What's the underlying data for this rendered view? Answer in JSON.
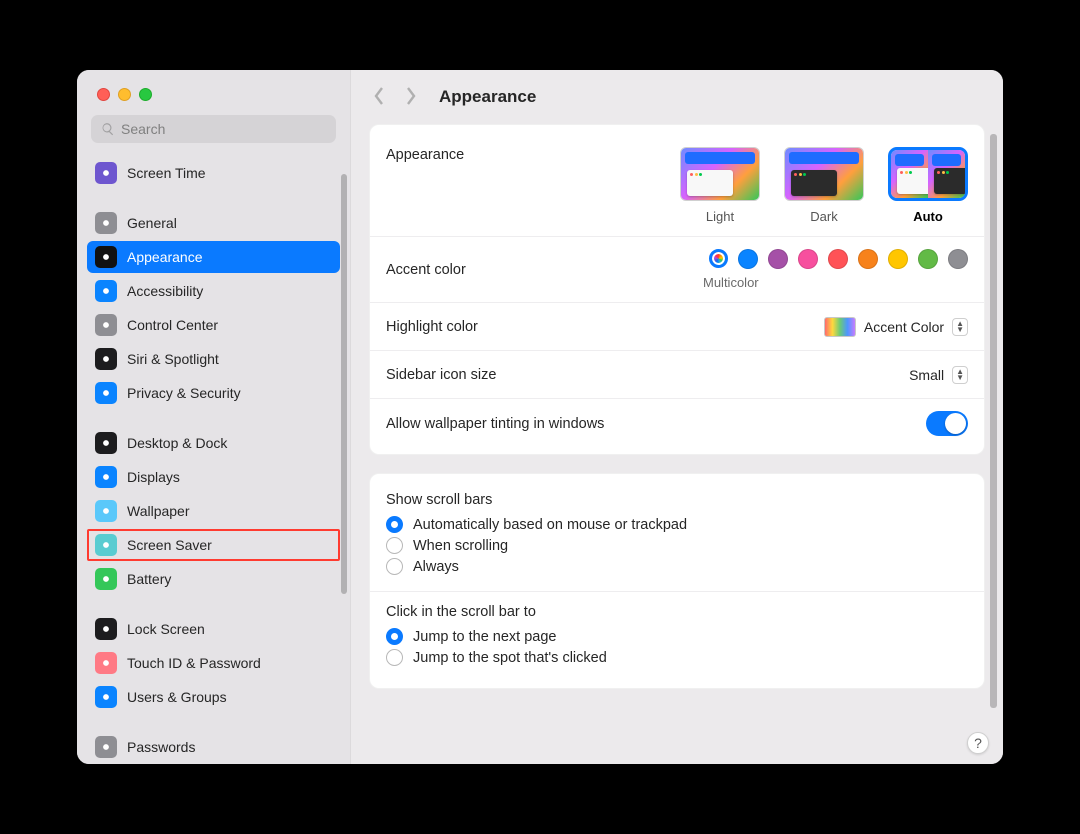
{
  "search": {
    "placeholder": "Search"
  },
  "title": "Appearance",
  "sidebar": {
    "sections": [
      {
        "items": [
          {
            "label": "Screen Time",
            "icon_bg": "#6e56cf",
            "id": "screen-time"
          }
        ]
      },
      {
        "items": [
          {
            "label": "General",
            "icon_bg": "#8e8e93",
            "id": "general"
          },
          {
            "label": "Appearance",
            "icon_bg": "#111111",
            "id": "appearance",
            "selected": true
          },
          {
            "label": "Accessibility",
            "icon_bg": "#0a84ff",
            "id": "accessibility"
          },
          {
            "label": "Control Center",
            "icon_bg": "#8e8e93",
            "id": "control-center"
          },
          {
            "label": "Siri & Spotlight",
            "icon_bg": "#1c1c1e",
            "id": "siri-spotlight"
          },
          {
            "label": "Privacy & Security",
            "icon_bg": "#0a84ff",
            "id": "privacy-security"
          }
        ]
      },
      {
        "items": [
          {
            "label": "Desktop & Dock",
            "icon_bg": "#1c1c1e",
            "id": "desktop-dock"
          },
          {
            "label": "Displays",
            "icon_bg": "#0a84ff",
            "id": "displays"
          },
          {
            "label": "Wallpaper",
            "icon_bg": "#5ac8fa",
            "id": "wallpaper"
          },
          {
            "label": "Screen Saver",
            "icon_bg": "#5accd1",
            "id": "screen-saver",
            "highlight": true
          },
          {
            "label": "Battery",
            "icon_bg": "#34c759",
            "id": "battery"
          }
        ]
      },
      {
        "items": [
          {
            "label": "Lock Screen",
            "icon_bg": "#1c1c1e",
            "id": "lock-screen"
          },
          {
            "label": "Touch ID & Password",
            "icon_bg": "#ff7a85",
            "id": "touch-id"
          },
          {
            "label": "Users & Groups",
            "icon_bg": "#0a84ff",
            "id": "users-groups"
          }
        ]
      },
      {
        "items": [
          {
            "label": "Passwords",
            "icon_bg": "#8e8e93",
            "id": "passwords"
          }
        ]
      }
    ]
  },
  "appearance_row": {
    "title": "Appearance",
    "options": [
      "Light",
      "Dark",
      "Auto"
    ],
    "selected": "Auto"
  },
  "accent_row": {
    "title": "Accent color",
    "selected_label": "Multicolor",
    "colors": [
      "#0a84ff",
      "#a550a7",
      "#f74f9e",
      "#ff5257",
      "#f7821b",
      "#ffc600",
      "#62ba46",
      "#8e8e93"
    ]
  },
  "highlight_row": {
    "title": "Highlight color",
    "value": "Accent Color"
  },
  "sidebar_size_row": {
    "title": "Sidebar icon size",
    "value": "Small"
  },
  "tinting_row": {
    "title": "Allow wallpaper tinting in windows",
    "on": true
  },
  "scroll_bars": {
    "title": "Show scroll bars",
    "options": [
      "Automatically based on mouse or trackpad",
      "When scrolling",
      "Always"
    ],
    "selected": 0
  },
  "scroll_click": {
    "title": "Click in the scroll bar to",
    "options": [
      "Jump to the next page",
      "Jump to the spot that's clicked"
    ],
    "selected": 0
  },
  "help_label": "?"
}
